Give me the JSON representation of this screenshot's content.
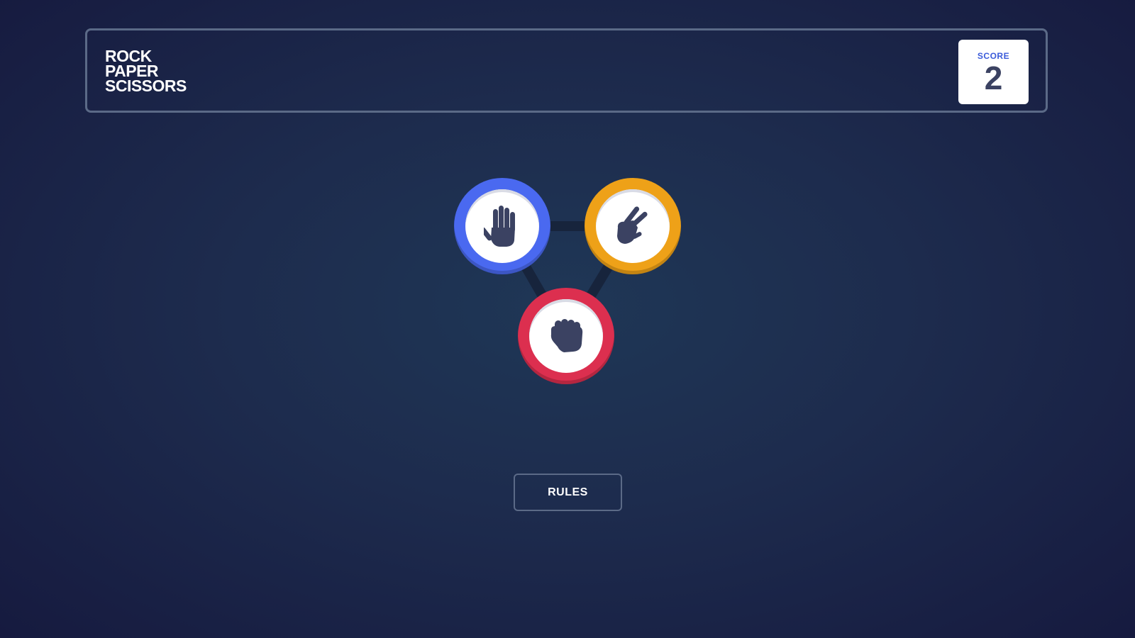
{
  "header": {
    "title_lines": [
      "ROCK",
      "PAPER",
      "SCISSORS"
    ],
    "score_label": "SCORE",
    "score_value": "2"
  },
  "tokens": [
    {
      "name": "paper",
      "icon": "paper-hand-icon",
      "color": "#4a69f0"
    },
    {
      "name": "scissors",
      "icon": "scissors-hand-icon",
      "color": "#eea118"
    },
    {
      "name": "rock",
      "icon": "rock-fist-icon",
      "color": "#dc2f4f"
    }
  ],
  "rules_button": {
    "label": "RULES"
  },
  "colors": {
    "background": "#1d2b4d",
    "border": "#5b6a87",
    "icon": "#3b4262",
    "score_label": "#3b5bda"
  }
}
